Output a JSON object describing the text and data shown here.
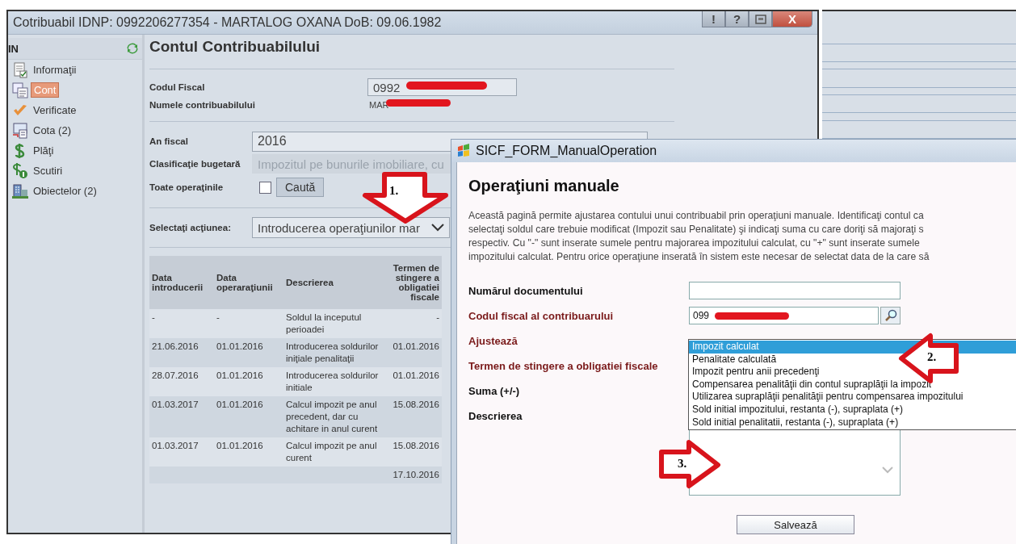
{
  "main_window": {
    "title": "Cotribuabil IDNP: 0992206277354 - MARTALOG OXANA DoB: 09.06.1982",
    "title_buttons": [
      {
        "kind": "glyph",
        "label": "!"
      },
      {
        "kind": "glyph",
        "label": "?"
      },
      {
        "kind": "restore"
      },
      {
        "kind": "close",
        "label": "X"
      }
    ]
  },
  "sidebar": {
    "header": "IN",
    "items": [
      {
        "label": "Informaţii",
        "kind": "document",
        "selected": false
      },
      {
        "label": "Cont",
        "kind": "cards",
        "selected": true
      },
      {
        "label": "Verificate",
        "kind": "check",
        "selected": false
      },
      {
        "label": "Cota (2)",
        "kind": "monitor",
        "selected": false
      },
      {
        "label": "Plăţi",
        "kind": "dollar",
        "selected": false
      },
      {
        "label": "Scutiri",
        "kind": "dollar-badge",
        "selected": false
      },
      {
        "label": "Obiectelor (2)",
        "kind": "building",
        "selected": false
      }
    ]
  },
  "account": {
    "title": "Contul Contribuabilului",
    "fiscal_code": {
      "label": "Codul Fiscal",
      "value": "0992"
    },
    "taxpayer_name": {
      "label": "Numele contribuabilului",
      "value": "MAR"
    },
    "fiscal_year": {
      "label": "An fiscal",
      "value": "2016"
    },
    "budget_classification": {
      "label": "Clasificaţie bugetară",
      "value": "Impozitul pe bunurile imobiliare, cu",
      "disabled": true
    },
    "all_operations": {
      "label": "Toate operaţinile",
      "checked": false,
      "button": "Caută"
    },
    "action": {
      "label": "Selectaţi acţiunea:",
      "value": "Introducerea operaţiunilor mar"
    },
    "table": {
      "columns": [
        "Data introducerii",
        "Data operaraţiunii",
        "Descrierea",
        "Termen de stingere a obligatiei fiscale"
      ],
      "rows": [
        {
          "cells": [
            "-",
            "-",
            "Soldul la inceputul perioadei",
            "-"
          ]
        },
        {
          "cells": [
            "21.06.2016",
            "01.01.2016",
            "Introducerea soldurilor iniţiale penalitaţii",
            "01.01.2016"
          ]
        },
        {
          "cells": [
            "28.07.2016",
            "01.01.2016",
            "Introducerea soldurilor initiale",
            "01.01.2016"
          ]
        },
        {
          "cells": [
            "01.03.2017",
            "01.01.2016",
            "Calcul impozit pe anul precedent, dar cu achitare in anul curent",
            "15.08.2016"
          ]
        },
        {
          "cells": [
            "01.03.2017",
            "01.01.2016",
            "Calcul impozit pe anul curent",
            "15.08.2016"
          ]
        },
        {
          "cells": [
            null,
            null,
            null,
            "17.10.2016"
          ]
        }
      ]
    }
  },
  "dialog": {
    "title": "SICF_FORM_ManualOperation",
    "heading": "Operaţiuni manuale",
    "description": [
      "Această pagină permite ajustarea contului unui contribuabil prin operaţiuni manuale. Identificaţi contul ca",
      "selectaţi soldul care trebuie modificat (Impozit sau Penalitate) şi indicaţi suma cu care doriţi să majoraţi s",
      "respectiv. Cu \"-\" sunt inserate sumele pentru majorarea impozitului calculat, cu \"+\" sunt inserate sumele",
      "impozitului calculat. Pentru orice operaţiune inserată în sistem este necesar de selectat data de la care să"
    ],
    "fields": [
      {
        "kind": "text",
        "label": "Numărul documentului",
        "required": false
      },
      {
        "kind": "lookup",
        "label": "Codul fiscal al contribuarului",
        "required": true,
        "value": "099"
      },
      {
        "kind": "select",
        "label": "Ajustează",
        "required": true
      },
      {
        "kind": "none",
        "label": "Termen de stingere a obligatiei fiscale",
        "required": true
      },
      {
        "kind": "none",
        "label": "Suma (+/-)",
        "required": false
      },
      {
        "kind": "textarea",
        "label": "Descrierea",
        "required": false
      }
    ],
    "dropdown_options": [
      {
        "label": "Impozit calculat",
        "selected": true
      },
      {
        "label": "Penalitate calculată",
        "selected": false
      },
      {
        "label": "Impozit pentru anii precedenţi",
        "selected": false
      },
      {
        "label": "Compensarea penalităţii din contul supraplăţii la impozit",
        "selected": false
      },
      {
        "label": "Utilizarea supraplăţii penalităţii pentru compensarea impozitului",
        "selected": false
      },
      {
        "label": "Sold initial impozitului, restanta (-), supraplata (+)",
        "selected": false
      },
      {
        "label": "Sold initial penalitatii, restanta (-), supraplata (+)",
        "selected": false
      }
    ],
    "save_button": "Salvează"
  },
  "annotations": [
    {
      "kind": "down",
      "label": "1."
    },
    {
      "kind": "left",
      "label": "2."
    },
    {
      "kind": "right",
      "label": "3."
    }
  ]
}
